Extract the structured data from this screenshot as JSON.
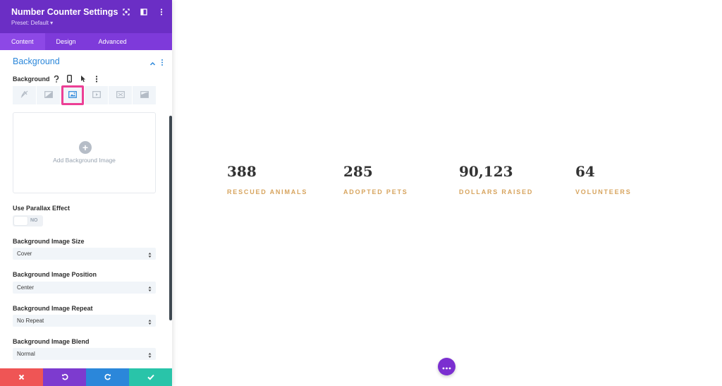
{
  "panel": {
    "title": "Number Counter Settings",
    "preset": "Preset: Default ▾",
    "tabs": [
      {
        "label": "Content"
      },
      {
        "label": "Design"
      },
      {
        "label": "Advanced"
      }
    ]
  },
  "section": {
    "title": "Background",
    "background_label": "Background",
    "upload_text": "Add Background Image",
    "bg_type_icons": [
      "no-color-icon",
      "gradient-icon",
      "image-icon",
      "video-icon",
      "pattern-icon",
      "mask-icon"
    ],
    "selected_bg_type": "image-icon"
  },
  "fields": {
    "parallax_label": "Use Parallax Effect",
    "parallax_value": "NO",
    "size_label": "Background Image Size",
    "size_value": "Cover",
    "position_label": "Background Image Position",
    "position_value": "Center",
    "repeat_label": "Background Image Repeat",
    "repeat_value": "No Repeat",
    "blend_label": "Background Image Blend",
    "blend_value": "Normal"
  },
  "stats": [
    {
      "number": "388",
      "label": "RESCUED ANIMALS"
    },
    {
      "number": "285",
      "label": "ADOPTED PETS"
    },
    {
      "number": "90,123",
      "label": "DOLLARS RAISED"
    },
    {
      "number": "64",
      "label": "VOLUNTEERS"
    }
  ],
  "colors": {
    "header": "#6b2ec5",
    "accent_blue": "#2b87da",
    "highlight": "#ec3f95",
    "stat_label": "#d7a45e",
    "cancel": "#ef5555",
    "undo": "#7d3bcf",
    "redo": "#2b87da",
    "save": "#29c4a9"
  }
}
